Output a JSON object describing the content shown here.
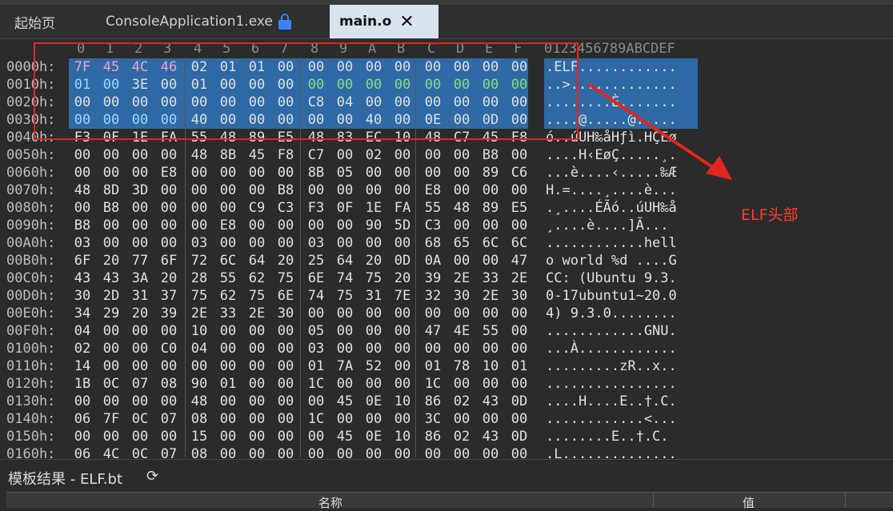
{
  "tabs": {
    "start": "起始页",
    "project": "ConsoleApplication1.exe",
    "active": "main.o"
  },
  "hex": {
    "columns": [
      "0",
      "1",
      "2",
      "3",
      "4",
      "5",
      "6",
      "7",
      "8",
      "9",
      "A",
      "B",
      "C",
      "D",
      "E",
      "F"
    ],
    "ascii_header": "0123456789ABCDEF",
    "rows": [
      {
        "addr": "0000h:",
        "bytes": [
          "7F",
          "45",
          "4C",
          "46",
          "02",
          "01",
          "01",
          "00",
          "00",
          "00",
          "00",
          "00",
          "00",
          "00",
          "00",
          "00"
        ],
        "ascii": ".ELF............"
      },
      {
        "addr": "0010h:",
        "bytes": [
          "01",
          "00",
          "3E",
          "00",
          "01",
          "00",
          "00",
          "00",
          "00",
          "00",
          "00",
          "00",
          "00",
          "00",
          "00",
          "00"
        ],
        "ascii": "..>............."
      },
      {
        "addr": "0020h:",
        "bytes": [
          "00",
          "00",
          "00",
          "00",
          "00",
          "00",
          "00",
          "00",
          "C8",
          "04",
          "00",
          "00",
          "00",
          "00",
          "00",
          "00"
        ],
        "ascii": "........È......."
      },
      {
        "addr": "0030h:",
        "bytes": [
          "00",
          "00",
          "00",
          "00",
          "40",
          "00",
          "00",
          "00",
          "00",
          "00",
          "40",
          "00",
          "0E",
          "00",
          "0D",
          "00"
        ],
        "ascii": "....@.....@....."
      },
      {
        "addr": "0040h:",
        "bytes": [
          "F3",
          "0F",
          "1E",
          "FA",
          "55",
          "48",
          "89",
          "E5",
          "48",
          "83",
          "EC",
          "10",
          "48",
          "C7",
          "45",
          "F8"
        ],
        "ascii": "ó..úUH‰åHƒì.HÇEø"
      },
      {
        "addr": "0050h:",
        "bytes": [
          "00",
          "00",
          "00",
          "00",
          "48",
          "8B",
          "45",
          "F8",
          "C7",
          "00",
          "02",
          "00",
          "00",
          "00",
          "B8",
          "00"
        ],
        "ascii": "....H‹EøÇ.....¸."
      },
      {
        "addr": "0060h:",
        "bytes": [
          "00",
          "00",
          "00",
          "E8",
          "00",
          "00",
          "00",
          "00",
          "8B",
          "05",
          "00",
          "00",
          "00",
          "00",
          "89",
          "C6"
        ],
        "ascii": "...è....‹.....‰Æ"
      },
      {
        "addr": "0070h:",
        "bytes": [
          "48",
          "8D",
          "3D",
          "00",
          "00",
          "00",
          "00",
          "B8",
          "00",
          "00",
          "00",
          "00",
          "E8",
          "00",
          "00",
          "00"
        ],
        "ascii": "H.=....¸....è..."
      },
      {
        "addr": "0080h:",
        "bytes": [
          "00",
          "B8",
          "00",
          "00",
          "00",
          "00",
          "C9",
          "C3",
          "F3",
          "0F",
          "1E",
          "FA",
          "55",
          "48",
          "89",
          "E5"
        ],
        "ascii": ".¸....ÉÃó..úUH‰å"
      },
      {
        "addr": "0090h:",
        "bytes": [
          "B8",
          "00",
          "00",
          "00",
          "00",
          "E8",
          "00",
          "00",
          "00",
          "00",
          "90",
          "5D",
          "C3",
          "00",
          "00",
          "00"
        ],
        "ascii": "¸....è....]Ã..."
      },
      {
        "addr": "00A0h:",
        "bytes": [
          "03",
          "00",
          "00",
          "00",
          "03",
          "00",
          "00",
          "00",
          "03",
          "00",
          "00",
          "00",
          "68",
          "65",
          "6C",
          "6C"
        ],
        "ascii": "............hell"
      },
      {
        "addr": "00B0h:",
        "bytes": [
          "6F",
          "20",
          "77",
          "6F",
          "72",
          "6C",
          "64",
          "20",
          "25",
          "64",
          "20",
          "0D",
          "0A",
          "00",
          "00",
          "47"
        ],
        "ascii": "o world %d ....G"
      },
      {
        "addr": "00C0h:",
        "bytes": [
          "43",
          "43",
          "3A",
          "20",
          "28",
          "55",
          "62",
          "75",
          "6E",
          "74",
          "75",
          "20",
          "39",
          "2E",
          "33",
          "2E"
        ],
        "ascii": "CC: (Ubuntu 9.3."
      },
      {
        "addr": "00D0h:",
        "bytes": [
          "30",
          "2D",
          "31",
          "37",
          "75",
          "62",
          "75",
          "6E",
          "74",
          "75",
          "31",
          "7E",
          "32",
          "30",
          "2E",
          "30"
        ],
        "ascii": "0-17ubuntu1~20.0"
      },
      {
        "addr": "00E0h:",
        "bytes": [
          "34",
          "29",
          "20",
          "39",
          "2E",
          "33",
          "2E",
          "30",
          "00",
          "00",
          "00",
          "00",
          "00",
          "00",
          "00",
          "00"
        ],
        "ascii": "4) 9.3.0........"
      },
      {
        "addr": "00F0h:",
        "bytes": [
          "04",
          "00",
          "00",
          "00",
          "10",
          "00",
          "00",
          "00",
          "05",
          "00",
          "00",
          "00",
          "47",
          "4E",
          "55",
          "00"
        ],
        "ascii": "............GNU."
      },
      {
        "addr": "0100h:",
        "bytes": [
          "02",
          "00",
          "00",
          "C0",
          "04",
          "00",
          "00",
          "00",
          "03",
          "00",
          "00",
          "00",
          "00",
          "00",
          "00",
          "00"
        ],
        "ascii": "...À............"
      },
      {
        "addr": "0110h:",
        "bytes": [
          "14",
          "00",
          "00",
          "00",
          "00",
          "00",
          "00",
          "00",
          "01",
          "7A",
          "52",
          "00",
          "01",
          "78",
          "10",
          "01"
        ],
        "ascii": ".........zR..x.."
      },
      {
        "addr": "0120h:",
        "bytes": [
          "1B",
          "0C",
          "07",
          "08",
          "90",
          "01",
          "00",
          "00",
          "1C",
          "00",
          "00",
          "00",
          "1C",
          "00",
          "00",
          "00"
        ],
        "ascii": "................"
      },
      {
        "addr": "0130h:",
        "bytes": [
          "00",
          "00",
          "00",
          "00",
          "48",
          "00",
          "00",
          "00",
          "00",
          "45",
          "0E",
          "10",
          "86",
          "02",
          "43",
          "0D"
        ],
        "ascii": "....H....E..†.C."
      },
      {
        "addr": "0140h:",
        "bytes": [
          "06",
          "7F",
          "0C",
          "07",
          "08",
          "00",
          "00",
          "00",
          "1C",
          "00",
          "00",
          "00",
          "3C",
          "00",
          "00",
          "00"
        ],
        "ascii": "............<..."
      },
      {
        "addr": "0150h:",
        "bytes": [
          "00",
          "00",
          "00",
          "00",
          "15",
          "00",
          "00",
          "00",
          "00",
          "45",
          "0E",
          "10",
          "86",
          "02",
          "43",
          "0D"
        ],
        "ascii": "........E..†.C."
      },
      {
        "addr": "0160h:",
        "bytes": [
          "06",
          "4C",
          "0C",
          "07",
          "08",
          "00",
          "00",
          "00",
          "00",
          "00",
          "00",
          "00",
          "00",
          "00",
          "00",
          "00"
        ],
        "ascii": ".L.............."
      }
    ]
  },
  "annotation": {
    "label": "ELF头部",
    "color": "#ff3b30"
  },
  "bottom": {
    "title": "模板结果 - ELF.bt",
    "col_name": "名称",
    "col_value": "值"
  },
  "colors": {
    "selection": "#2f6aa6",
    "highlight": "#e2261d"
  }
}
